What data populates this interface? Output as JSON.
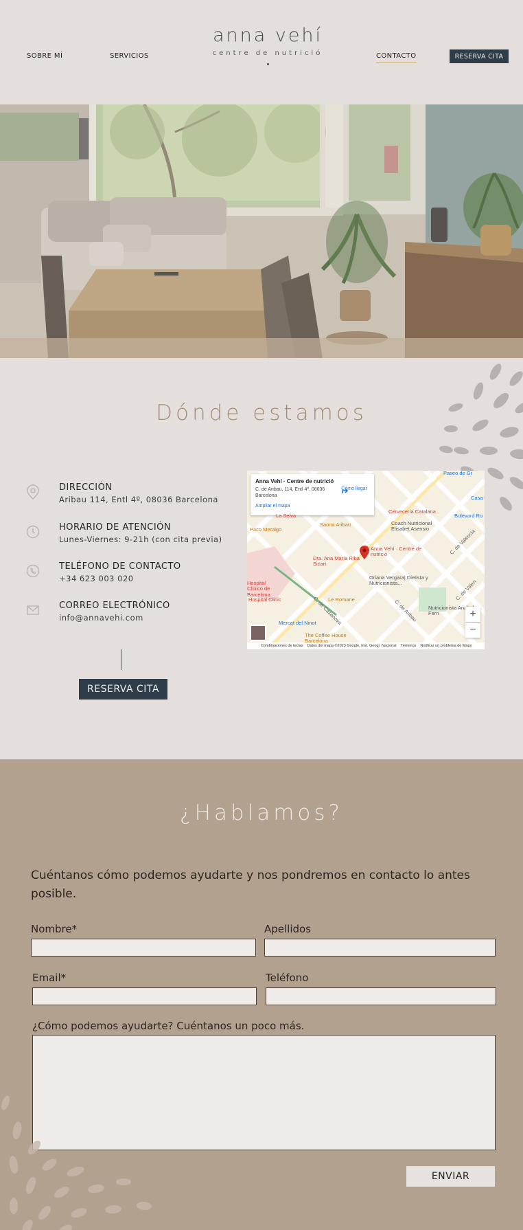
{
  "header": {
    "nav": {
      "about": "SOBRE MÍ",
      "services": "SERVICIOS",
      "contact": "CONTACTO",
      "cta": "RESERVA CITA"
    },
    "logo": {
      "name": "anna vehí",
      "subtitle": "centre de nutrició"
    }
  },
  "location": {
    "title": "Dónde estamos",
    "items": [
      {
        "icon": "location-pin-icon",
        "heading": "DIRECCIÓN",
        "value": "Aribau 114, Entl 4º, 08036 Barcelona"
      },
      {
        "icon": "clock-icon",
        "heading": "HORARIO DE ATENCIÓN",
        "value": "Lunes-Viernes: 9-21h (con cita previa)"
      },
      {
        "icon": "phone-icon",
        "heading": "TELÉFONO DE CONTACTO",
        "value": "+34 623 003 020"
      },
      {
        "icon": "mail-icon",
        "heading": "CORREO ELECTRÓNICO",
        "value": "info@annavehi.com"
      }
    ],
    "cta": "RESERVA CITA"
  },
  "map": {
    "card_title": "Anna Vehí · Centre de nutrició",
    "card_address": "C. de Aribau, 114, Entl 4ª, 08036 Barcelona",
    "card_directions": "Cómo llegar",
    "card_link": "Ampliar el mapa",
    "places": [
      "La Selva",
      "Saona Aribau",
      "Coach Nutricional Elisabet Asensio",
      "Paco Meralgo",
      "Cervecería Catalana",
      "Bulevard Ro",
      "Anna Vehí · Centre de nutrició",
      "Dra. Ana María Riba Sicart",
      "Oriana Vergara| Dietista y Nutricionista...",
      "Hospital Clínico de Barcelona",
      "Hospital Clinic",
      "Le Romane",
      "Mercat del Ninot",
      "Nutricionista Anabel Fern",
      "The Coffee House Barcelona",
      "Paseo de Gr",
      "Casa",
      "C. de València",
      "C. de Casanova",
      "C. de Aribau",
      "C. de Valen"
    ],
    "zoom_in": "+",
    "zoom_out": "−",
    "footer": [
      "Combinaciones de teclas",
      "Datos del mapa ©2023 Google, Inst. Geogr. Nacional",
      "Términos",
      "Notificar un problema de Maps"
    ]
  },
  "contact": {
    "title": "¿Hablamos?",
    "intro": "Cuéntanos cómo podemos ayudarte y nos pondremos en contacto lo antes posible.",
    "fields": {
      "nombre": {
        "label": "Nombre*",
        "value": ""
      },
      "apellidos": {
        "label": "Apellidos",
        "value": ""
      },
      "email": {
        "label": "Email*",
        "value": ""
      },
      "telefono": {
        "label": "Teléfono",
        "value": ""
      },
      "mensaje": {
        "label": "¿Cómo podemos ayudarte? Cuéntanos un poco más.",
        "value": ""
      }
    },
    "submit": "ENVIAR"
  }
}
